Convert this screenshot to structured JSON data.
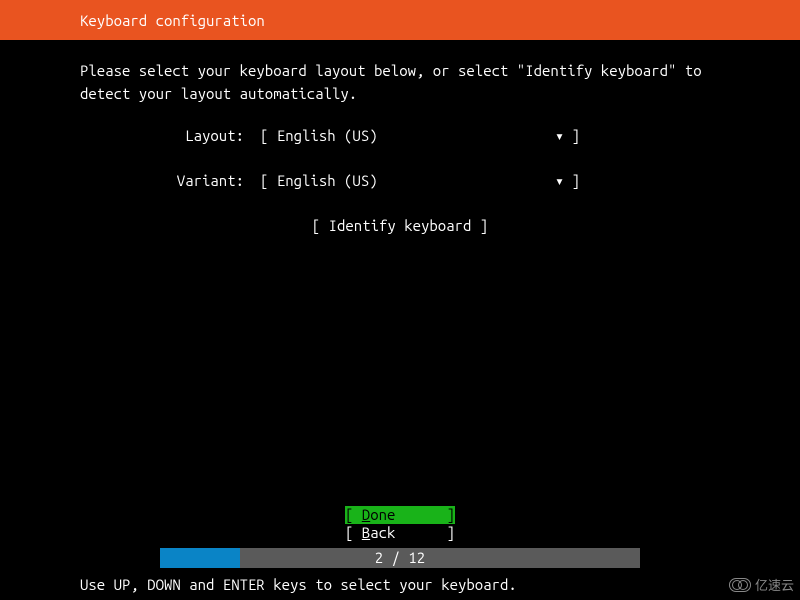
{
  "header": {
    "title": "Keyboard configuration"
  },
  "instruction": "Please select your keyboard layout below, or select \"Identify keyboard\" to detect your layout automatically.",
  "form": {
    "layout": {
      "label": "Layout:",
      "value": "English (US)"
    },
    "variant": {
      "label": "Variant:",
      "value": "English (US)"
    },
    "identify": {
      "label": "Identify keyboard"
    }
  },
  "nav": {
    "done": "Done",
    "back": "Back"
  },
  "progress": {
    "current": 2,
    "total": 12,
    "label": "2 / 12",
    "percent": 16.67
  },
  "hint": "Use UP, DOWN and ENTER keys to select your keyboard.",
  "watermark": "亿速云"
}
